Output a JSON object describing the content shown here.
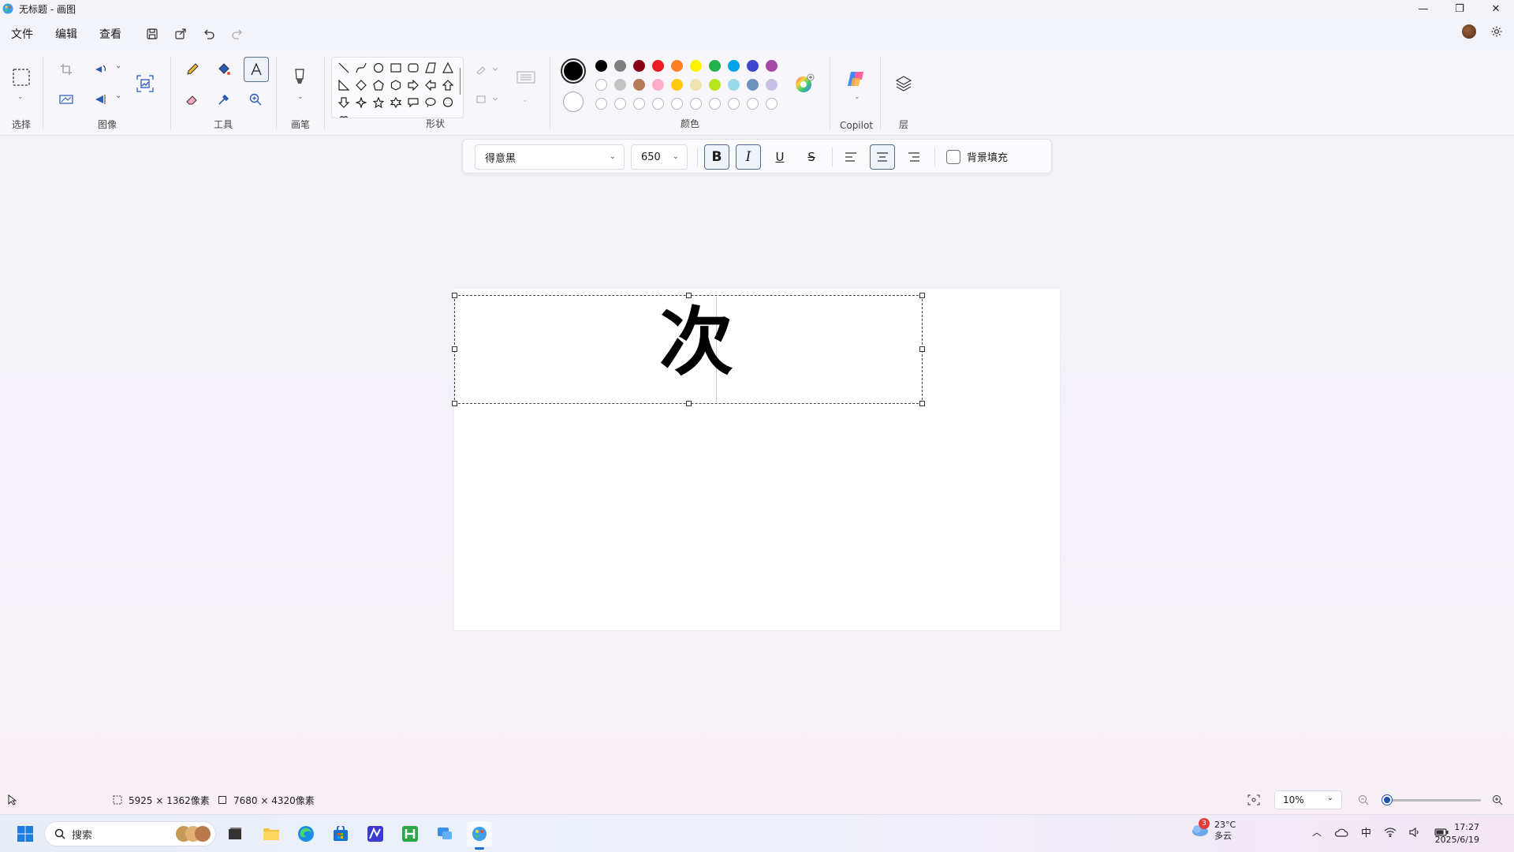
{
  "window": {
    "title": "无标题 - 画图",
    "minimize": "—",
    "maximize": "❐",
    "close": "✕"
  },
  "menu": {
    "items": [
      "文件",
      "编辑",
      "查看"
    ]
  },
  "ribbon": {
    "groups": {
      "select": "选择",
      "image": "图像",
      "tools": "工具",
      "brushes": "画笔",
      "shapes": "形状",
      "colors": "颜色",
      "copilot": "Copilot",
      "layers": "层"
    },
    "palette_row1": [
      "#000000",
      "#7f7f7f",
      "#880015",
      "#ed1c24",
      "#ff7f27",
      "#fff200",
      "#22b14c",
      "#00a2e8",
      "#3f48cc",
      "#a349a4"
    ],
    "palette_row2": [
      "#ffffff",
      "#c3c3c3",
      "#b97a57",
      "#ffaec9",
      "#ffc90e",
      "#efe4b0",
      "#b5e61d",
      "#99d9ea",
      "#7092be",
      "#c8bfe7"
    ],
    "primary_color": "#000000",
    "secondary_color": "#ffffff"
  },
  "text_toolbar": {
    "font": "得意黑",
    "size": "650",
    "bold": "B",
    "italic": "I",
    "underline": "U",
    "strike": "S",
    "bg_fill": "背景填充"
  },
  "canvas": {
    "text": "次"
  },
  "status": {
    "selection_size": "5925 × 1362像素",
    "canvas_size": "7680 × 4320像素",
    "zoom": "10%",
    "zoom_level_percent": 10
  },
  "taskbar": {
    "search_placeholder": "搜索",
    "weather_temp": "23°C",
    "weather_desc": "多云",
    "weather_badge": "3",
    "ime": "中",
    "time": "17:27",
    "date": "2025/6/19"
  }
}
